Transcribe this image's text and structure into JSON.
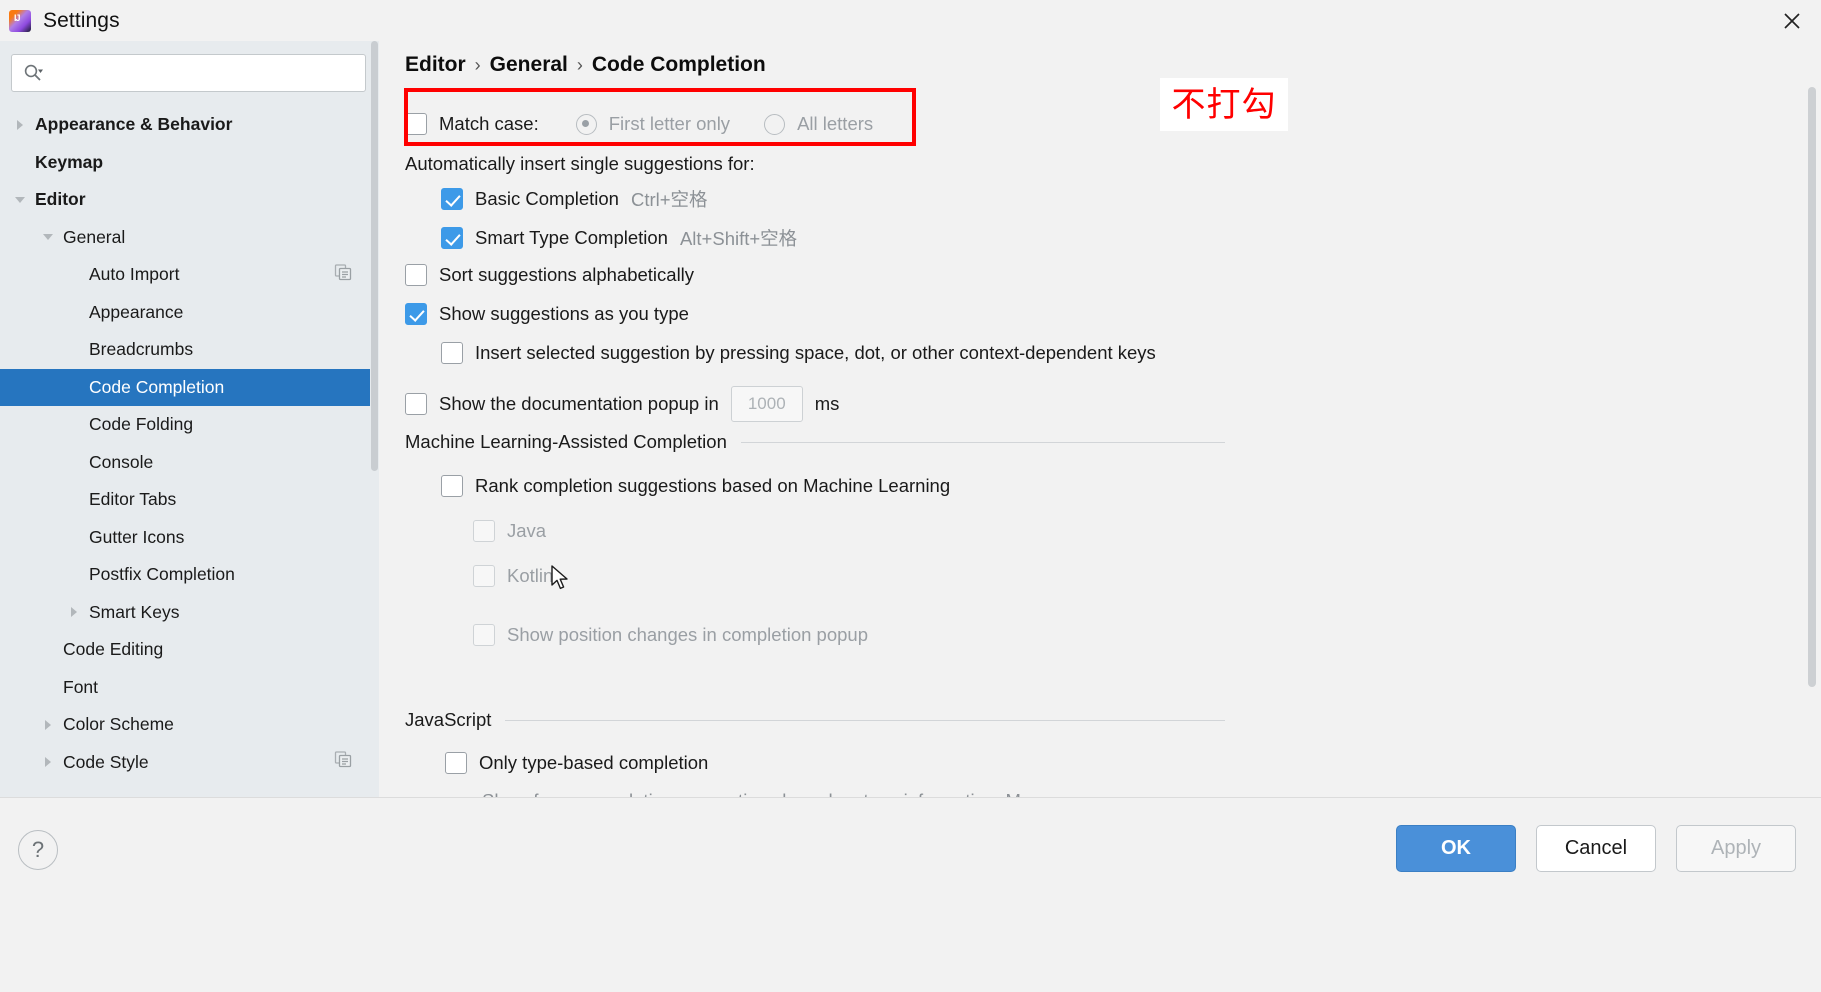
{
  "window": {
    "title": "Settings",
    "logo_icon": "intellij-idea-logo",
    "close_icon": "close-icon"
  },
  "sidebar": {
    "search": {
      "placeholder": "",
      "value": "",
      "icon": "search-dropdown-icon"
    },
    "items": [
      {
        "label": "Appearance & Behavior",
        "indent": 0,
        "bold": true,
        "twisty": "right",
        "selected": false,
        "copy_icon": false
      },
      {
        "label": "Keymap",
        "indent": 0,
        "bold": true,
        "twisty": "none",
        "selected": false,
        "copy_icon": false
      },
      {
        "label": "Editor",
        "indent": 0,
        "bold": true,
        "twisty": "down",
        "selected": false,
        "copy_icon": false
      },
      {
        "label": "General",
        "indent": 1,
        "bold": false,
        "twisty": "down",
        "selected": false,
        "copy_icon": false
      },
      {
        "label": "Auto Import",
        "indent": 2,
        "bold": false,
        "twisty": "none",
        "selected": false,
        "copy_icon": true
      },
      {
        "label": "Appearance",
        "indent": 2,
        "bold": false,
        "twisty": "none",
        "selected": false,
        "copy_icon": false
      },
      {
        "label": "Breadcrumbs",
        "indent": 2,
        "bold": false,
        "twisty": "none",
        "selected": false,
        "copy_icon": false
      },
      {
        "label": "Code Completion",
        "indent": 2,
        "bold": false,
        "twisty": "none",
        "selected": true,
        "copy_icon": false
      },
      {
        "label": "Code Folding",
        "indent": 2,
        "bold": false,
        "twisty": "none",
        "selected": false,
        "copy_icon": false
      },
      {
        "label": "Console",
        "indent": 2,
        "bold": false,
        "twisty": "none",
        "selected": false,
        "copy_icon": false
      },
      {
        "label": "Editor Tabs",
        "indent": 2,
        "bold": false,
        "twisty": "none",
        "selected": false,
        "copy_icon": false
      },
      {
        "label": "Gutter Icons",
        "indent": 2,
        "bold": false,
        "twisty": "none",
        "selected": false,
        "copy_icon": false
      },
      {
        "label": "Postfix Completion",
        "indent": 2,
        "bold": false,
        "twisty": "none",
        "selected": false,
        "copy_icon": false
      },
      {
        "label": "Smart Keys",
        "indent": 2,
        "bold": false,
        "twisty": "right",
        "selected": false,
        "copy_icon": false
      },
      {
        "label": "Code Editing",
        "indent": 1,
        "bold": false,
        "twisty": "none",
        "selected": false,
        "copy_icon": false
      },
      {
        "label": "Font",
        "indent": 1,
        "bold": false,
        "twisty": "none",
        "selected": false,
        "copy_icon": false
      },
      {
        "label": "Color Scheme",
        "indent": 1,
        "bold": false,
        "twisty": "right",
        "selected": false,
        "copy_icon": false
      },
      {
        "label": "Code Style",
        "indent": 1,
        "bold": false,
        "twisty": "right",
        "selected": false,
        "copy_icon": true
      }
    ]
  },
  "breadcrumb": {
    "part1": "Editor",
    "sep1": "›",
    "part2": "General",
    "sep2": "›",
    "part3": "Code Completion"
  },
  "main": {
    "match_case": {
      "label": "Match case:",
      "checked": false,
      "radios": [
        {
          "label": "First letter only",
          "selected": true,
          "disabled": true
        },
        {
          "label": "All letters",
          "selected": false,
          "disabled": true
        }
      ]
    },
    "auto_insert_label": "Automatically insert single suggestions for:",
    "auto_insert_items": [
      {
        "label": "Basic Completion",
        "shortcut": "Ctrl+空格",
        "checked": true
      },
      {
        "label": "Smart Type Completion",
        "shortcut": "Alt+Shift+空格",
        "checked": true
      }
    ],
    "sort_alphabetically": {
      "label": "Sort suggestions alphabetically",
      "checked": false
    },
    "show_as_you_type": {
      "label": "Show suggestions as you type",
      "checked": true
    },
    "insert_on_keys": {
      "label": "Insert selected suggestion by pressing space, dot, or other context-dependent keys",
      "checked": false
    },
    "doc_popup": {
      "label_before": "Show the documentation popup in",
      "value": "1000",
      "unit": "ms",
      "checked": false
    },
    "ml_section": {
      "title": "Machine Learning-Assisted Completion",
      "rank": {
        "label": "Rank completion suggestions based on Machine Learning",
        "checked": false,
        "disabled": false
      },
      "languages": [
        {
          "label": "Java",
          "checked": false,
          "disabled": true
        },
        {
          "label": "Kotlin",
          "checked": false,
          "disabled": true
        }
      ],
      "show_position": {
        "label": "Show position changes in completion popup",
        "checked": false,
        "disabled": true
      }
    },
    "javascript_section": {
      "title": "JavaScript",
      "only_type_based": {
        "label": "Only type-based completion",
        "checked": false
      },
      "description": "Show fewer completion suggestions based on type information. May"
    }
  },
  "annotation": {
    "text": "不打勾",
    "color": "#ff0000",
    "box_color": "#ff0000"
  },
  "footer": {
    "help_label": "?",
    "ok_label": "OK",
    "cancel_label": "Cancel",
    "apply_label": "Apply",
    "apply_disabled": true
  }
}
